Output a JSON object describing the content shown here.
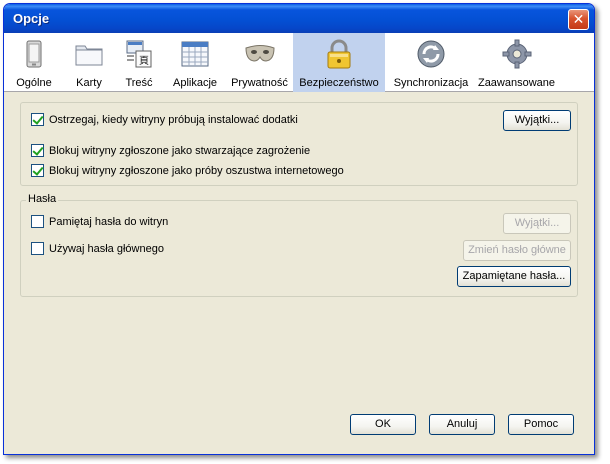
{
  "window": {
    "title": "Opcje"
  },
  "tabs": [
    {
      "label": "Ogólne",
      "icon": "phone-icon"
    },
    {
      "label": "Karty",
      "icon": "folder-tabs-icon"
    },
    {
      "label": "Treść",
      "icon": "document-text-icon"
    },
    {
      "label": "Aplikacje",
      "icon": "calendar-grid-icon"
    },
    {
      "label": "Prywatność",
      "icon": "mask-icon"
    },
    {
      "label": "Bezpieczeństwo",
      "icon": "padlock-icon",
      "selected": true
    },
    {
      "label": "Synchronizacja",
      "icon": "sync-icon"
    },
    {
      "label": "Zaawansowane",
      "icon": "gear-icon"
    }
  ],
  "security": {
    "addons_warn": {
      "label": "Ostrzegaj, kiedy witryny próbują instalować dodatki",
      "checked": true
    },
    "addons_exceptions": "Wyjątki...",
    "block_threat": {
      "label": "Blokuj witryny zgłoszone jako stwarzające zagrożenie",
      "checked": true
    },
    "block_fraud": {
      "label": "Blokuj witryny zgłoszone jako próby oszustwa internetowego",
      "checked": true
    }
  },
  "passwords": {
    "legend": "Hasła",
    "remember": {
      "label": "Pamiętaj hasła do witryn",
      "checked": false
    },
    "exceptions": "Wyjątki...",
    "master": {
      "label": "Używaj hasła głównego",
      "checked": false
    },
    "change_master": "Zmień hasło główne",
    "saved": "Zapamiętane hasła..."
  },
  "footer": {
    "ok": "OK",
    "cancel": "Anuluj",
    "help": "Pomoc"
  },
  "colors": {
    "title_bar": "#0450d4",
    "dialog_bg": "#ece9d8",
    "selected_tab": "#c1d2ee",
    "close_button": "#d8532e"
  }
}
